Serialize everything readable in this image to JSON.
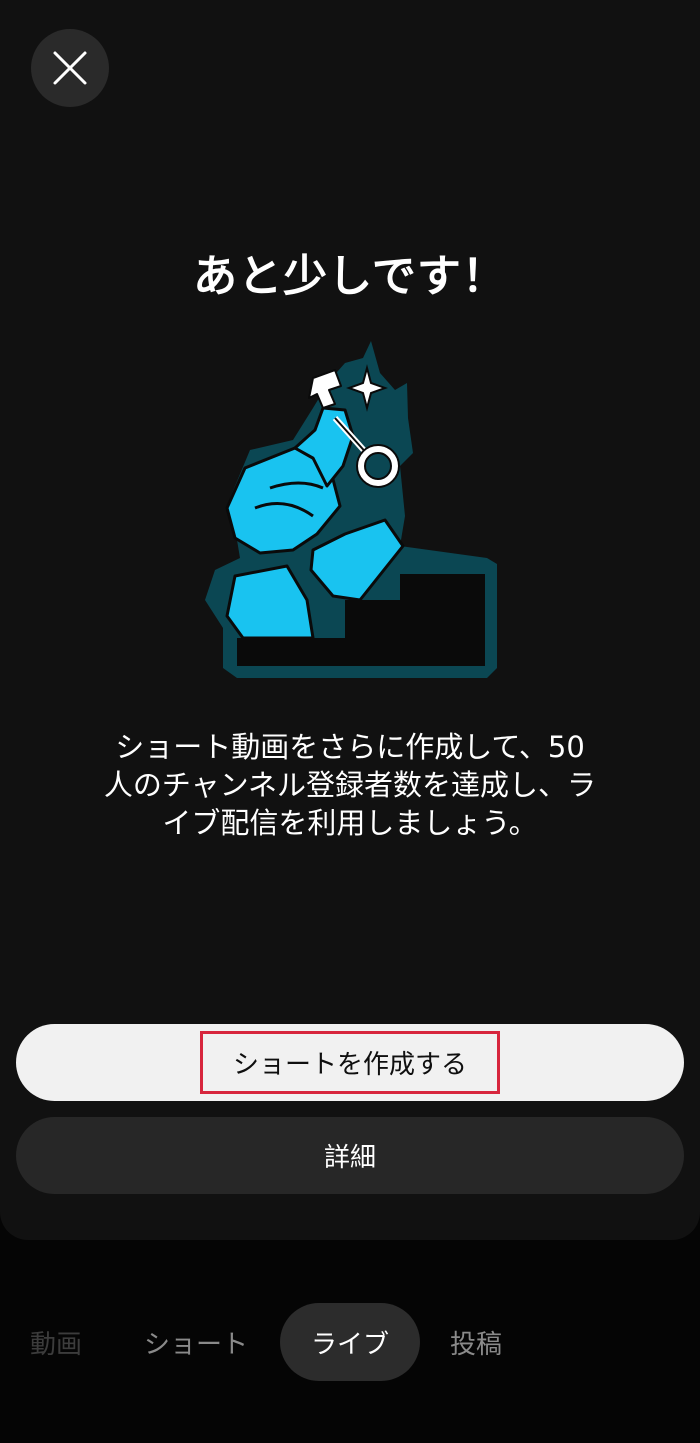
{
  "dialog": {
    "close_icon": "close-icon",
    "title": "あと少しです！",
    "illustration": "key-climbing-steps-illustration",
    "description_lines": [
      "ショート動画をさらに作成して、50",
      "人のチャンネル登録者数を達成し、ラ",
      "イブ配信を利用しましょう。"
    ],
    "primary_button": "ショートを作成する",
    "secondary_button": "詳細"
  },
  "tabs": [
    {
      "label": "動画",
      "selected": false
    },
    {
      "label": "ショート",
      "selected": false
    },
    {
      "label": "ライブ",
      "selected": true
    },
    {
      "label": "投稿",
      "selected": false
    }
  ],
  "colors": {
    "sheet_background": "#111111",
    "illustration_cyan": "#19c3f0",
    "illustration_teal": "#0b4753",
    "highlight_border": "#d7263d",
    "primary_button": "#f1f1f1",
    "secondary_button": "#272727"
  }
}
